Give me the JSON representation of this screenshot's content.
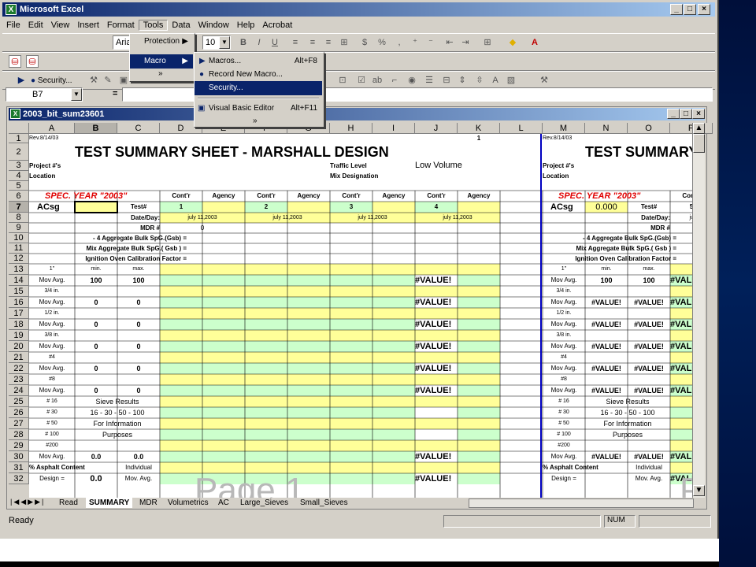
{
  "app": {
    "title": "Microsoft Excel",
    "min": "_",
    "max": "□",
    "close": "×"
  },
  "menubar": [
    "File",
    "Edit",
    "View",
    "Insert",
    "Format",
    "Tools",
    "Data",
    "Window",
    "Help",
    "Acrobat"
  ],
  "toolbar": {
    "font_name": "Arial",
    "font_size": "10",
    "security_label": "Security..."
  },
  "formula_bar": {
    "name_box": "B7",
    "equals": "="
  },
  "tools_menu": {
    "protection": "Protection",
    "macro": "Macro",
    "more": "»"
  },
  "macro_submenu": {
    "items": [
      {
        "label": "Macros...",
        "shortcut": "Alt+F8"
      },
      {
        "label": "Record New Macro...",
        "shortcut": ""
      },
      {
        "label": "Security...",
        "shortcut": ""
      },
      {
        "label": "Visual Basic Editor",
        "shortcut": "Alt+F11"
      }
    ],
    "more": "»"
  },
  "workbook": {
    "title": "2003_bit_sum23601"
  },
  "columns": [
    "A",
    "B",
    "C",
    "D",
    "E",
    "F",
    "G",
    "H",
    "I",
    "J",
    "K",
    "L",
    "M",
    "N",
    "O",
    "P"
  ],
  "rows": [
    "1",
    "2",
    "3",
    "4",
    "5",
    "6",
    "7",
    "8",
    "9",
    "10",
    "11",
    "12",
    "13",
    "14",
    "15",
    "16",
    "17",
    "18",
    "19",
    "20",
    "21",
    "22",
    "23",
    "24",
    "25",
    "26",
    "27",
    "28",
    "29",
    "30",
    "31",
    "32"
  ],
  "sheet": {
    "rev": "Rev.8/14/03",
    "page_num": "1",
    "title": "TEST SUMMARY SHEET  -   MARSHALL DESIGN",
    "title_right": "TEST SUMMARY",
    "project": "Project #'s",
    "location": "Location",
    "traffic_level": "Traffic Level",
    "traffic_value": "Low Volume",
    "mix_designation": "Mix Designation",
    "spec_year": "SPEC. YEAR  \"2003\"",
    "contr": "Cont'r",
    "agency": "Agency",
    "acsg": "ACsg",
    "acsg_right_value": "0.000",
    "test_no": "Test#",
    "test_nums": [
      "1",
      "2",
      "3",
      "4",
      "5"
    ],
    "date_day": "Date/Day:",
    "date_value": "july 11,2003",
    "date_right": "july 11,20",
    "mdr": "MDR #",
    "mdr_value": "0",
    "agg_bulk_4": "- 4  Aggregate Bulk SpG.(Gsb) =",
    "mix_agg_bulk": "Mix  Aggregate Bulk SpG.( Gsb ) =",
    "ignition": "Ignition Oven Calibration Factor =",
    "sieve_1": "1\"",
    "min": "min.",
    "max": "max.",
    "mov_avg": "Mov Avg.",
    "sieves": [
      "3/4 in.",
      "1/2 in.",
      "3/8 in.",
      "#4",
      "#8"
    ],
    "hundred": "100",
    "zero": "0",
    "zero_dec": "0.0",
    "value_err": "#VALUE!",
    "sieve_results": [
      "# 16",
      "# 30",
      "# 50",
      "# 100"
    ],
    "sieve_results_text": [
      "Sieve Results",
      "16 - 30 - 50 - 100",
      "For Information",
      "Purposes"
    ],
    "sieve_200": "#200",
    "asphalt_content": "% Asphalt Content",
    "design": "Design =",
    "individual": "Individual",
    "mov_avg2": "Mov. Avg.",
    "page_watermark": "Page 1",
    "watermark_right": "P"
  },
  "sheet_tabs": [
    "Read",
    "SUMMARY",
    "MDR",
    "Volumetrics",
    "AC",
    "Large_Sieves",
    "Small_Sieves"
  ],
  "status": {
    "ready": "Ready",
    "num": "NUM"
  }
}
